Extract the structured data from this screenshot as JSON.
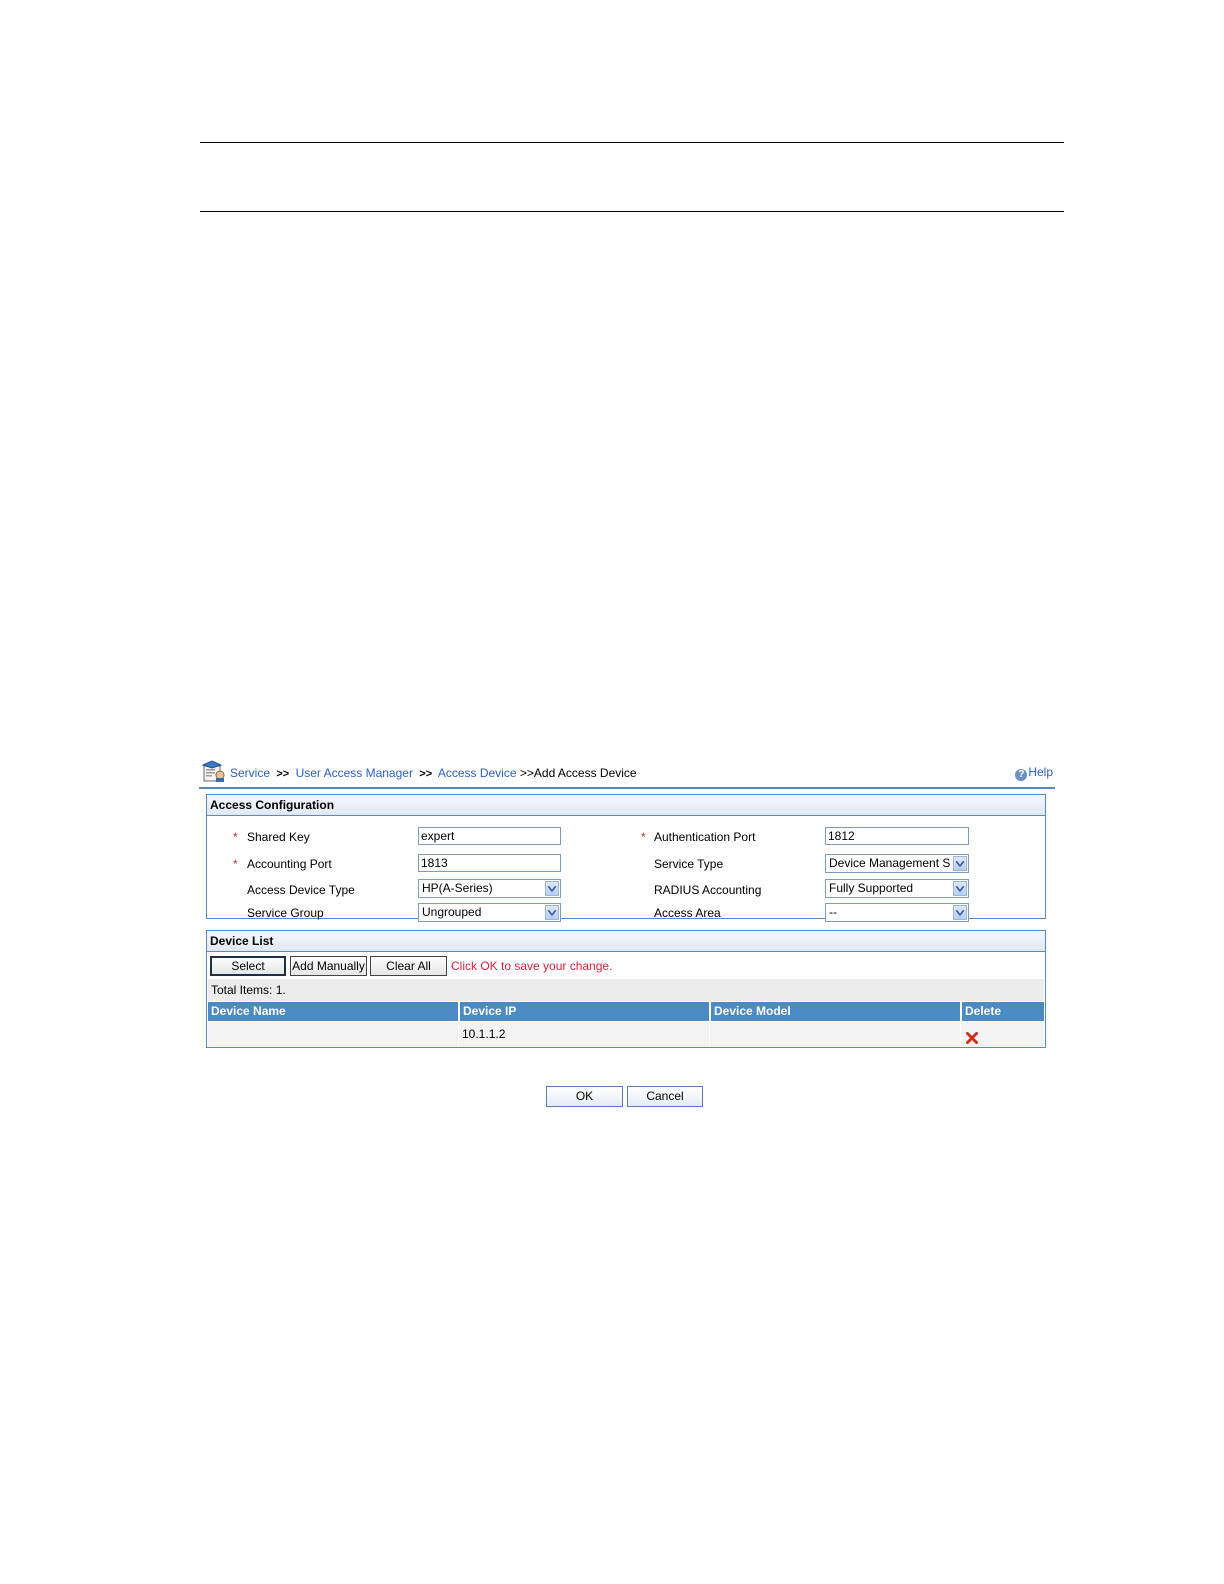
{
  "breadcrumb": {
    "service": "Service",
    "uam": "User Access Manager",
    "access_device": "Access Device",
    "separator": ">>",
    "current": ">>Add Access Device"
  },
  "help": {
    "label": "Help",
    "glyph": "?"
  },
  "access_config": {
    "title": "Access Configuration",
    "required_mark": "*",
    "shared_key": {
      "label": "Shared Key",
      "value": "expert"
    },
    "auth_port": {
      "label": "Authentication Port",
      "value": "1812"
    },
    "acct_port": {
      "label": "Accounting Port",
      "value": "1813"
    },
    "service_type": {
      "label": "Service Type",
      "value": "Device Management Se"
    },
    "device_type": {
      "label": "Access Device Type",
      "value": "HP(A-Series)"
    },
    "radius_acct": {
      "label": "RADIUS Accounting",
      "value": "Fully Supported"
    },
    "service_group": {
      "label": "Service Group",
      "value": "Ungrouped"
    },
    "access_area": {
      "label": "Access Area",
      "value": "--"
    }
  },
  "device_list": {
    "title": "Device List",
    "select_label": "Select",
    "add_manually_label": "Add Manually",
    "clear_all_label": "Clear All",
    "hint": "Click OK to save your change.",
    "total": "Total Items: 1.",
    "columns": [
      "Device Name",
      "Device IP",
      "Device Model",
      "Delete"
    ],
    "rows": [
      {
        "name": "",
        "ip": "10.1.1.2",
        "model": ""
      }
    ]
  },
  "actions": {
    "ok": "OK",
    "cancel": "Cancel"
  },
  "colors": {
    "accent": "#4c8ac4",
    "link": "#2a5fc8",
    "hint": "#e0203c",
    "delete": "#d03020"
  }
}
